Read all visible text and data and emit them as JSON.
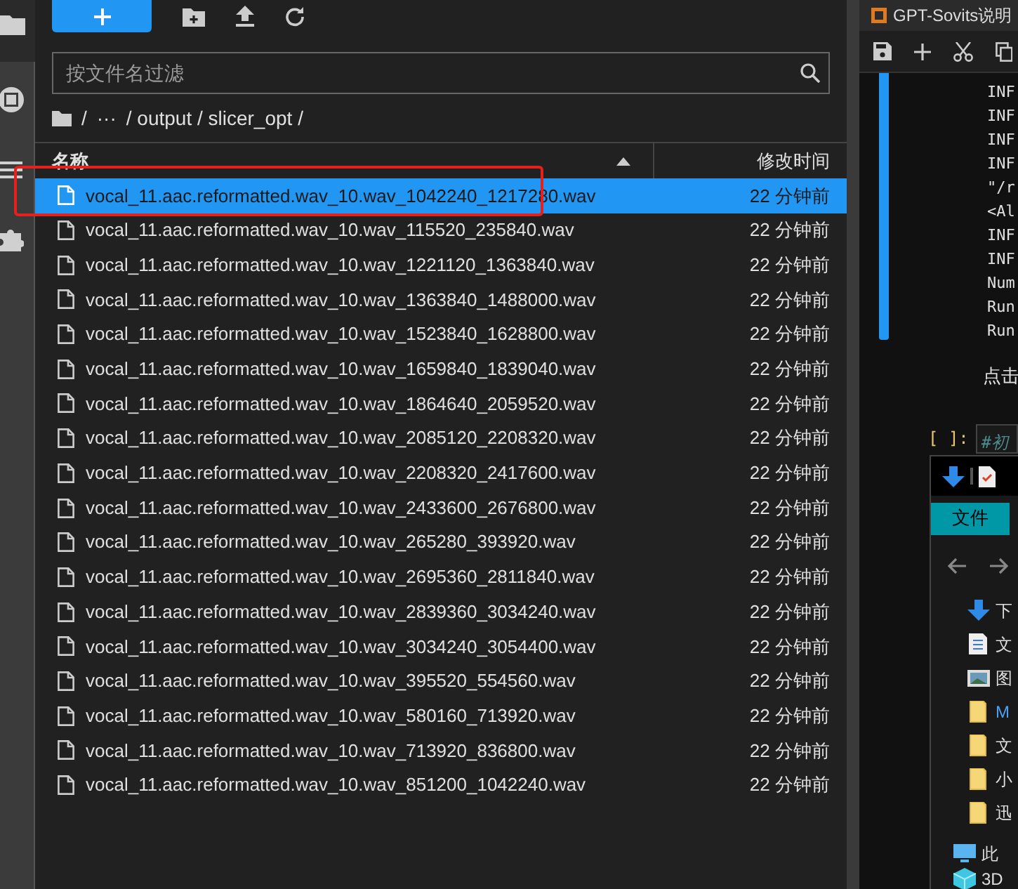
{
  "file_browser": {
    "filter": {
      "placeholder": "按文件名过滤"
    },
    "breadcrumb": [
      "/",
      "···",
      "/ output / slicer_opt /"
    ],
    "columns": [
      {
        "label": "名称",
        "sorted": true
      },
      {
        "label": "修改时间"
      }
    ],
    "files": [
      {
        "name": "vocal_11.aac.reformatted.wav_10.wav_1042240_1217280.wav",
        "modified": "22 分钟前",
        "selected": true
      },
      {
        "name": "vocal_11.aac.reformatted.wav_10.wav_115520_235840.wav",
        "modified": "22 分钟前",
        "selected": false
      },
      {
        "name": "vocal_11.aac.reformatted.wav_10.wav_1221120_1363840.wav",
        "modified": "22 分钟前",
        "selected": false
      },
      {
        "name": "vocal_11.aac.reformatted.wav_10.wav_1363840_1488000.wav",
        "modified": "22 分钟前",
        "selected": false
      },
      {
        "name": "vocal_11.aac.reformatted.wav_10.wav_1523840_1628800.wav",
        "modified": "22 分钟前",
        "selected": false
      },
      {
        "name": "vocal_11.aac.reformatted.wav_10.wav_1659840_1839040.wav",
        "modified": "22 分钟前",
        "selected": false
      },
      {
        "name": "vocal_11.aac.reformatted.wav_10.wav_1864640_2059520.wav",
        "modified": "22 分钟前",
        "selected": false
      },
      {
        "name": "vocal_11.aac.reformatted.wav_10.wav_2085120_2208320.wav",
        "modified": "22 分钟前",
        "selected": false
      },
      {
        "name": "vocal_11.aac.reformatted.wav_10.wav_2208320_2417600.wav",
        "modified": "22 分钟前",
        "selected": false
      },
      {
        "name": "vocal_11.aac.reformatted.wav_10.wav_2433600_2676800.wav",
        "modified": "22 分钟前",
        "selected": false
      },
      {
        "name": "vocal_11.aac.reformatted.wav_10.wav_265280_393920.wav",
        "modified": "22 分钟前",
        "selected": false
      },
      {
        "name": "vocal_11.aac.reformatted.wav_10.wav_2695360_2811840.wav",
        "modified": "22 分钟前",
        "selected": false
      },
      {
        "name": "vocal_11.aac.reformatted.wav_10.wav_2839360_3034240.wav",
        "modified": "22 分钟前",
        "selected": false
      },
      {
        "name": "vocal_11.aac.reformatted.wav_10.wav_3034240_3054400.wav",
        "modified": "22 分钟前",
        "selected": false
      },
      {
        "name": "vocal_11.aac.reformatted.wav_10.wav_395520_554560.wav",
        "modified": "22 分钟前",
        "selected": false
      },
      {
        "name": "vocal_11.aac.reformatted.wav_10.wav_580160_713920.wav",
        "modified": "22 分钟前",
        "selected": false
      },
      {
        "name": "vocal_11.aac.reformatted.wav_10.wav_713920_836800.wav",
        "modified": "22 分钟前",
        "selected": false
      },
      {
        "name": "vocal_11.aac.reformatted.wav_10.wav_851200_1042240.wav",
        "modified": "22 分钟前",
        "selected": false
      }
    ]
  },
  "notebook": {
    "tab_title": "GPT-Sovits说明",
    "output_lines": [
      "INF",
      "INF",
      "INF",
      "INF",
      "\"/r",
      "<Al",
      "INF",
      "INF",
      "Num",
      "Run",
      "Run"
    ],
    "markdown": "点击",
    "cell": {
      "prompt": "[ ]:",
      "code": "#初"
    }
  },
  "explorer": {
    "ribbon_tab": "文件",
    "items": [
      {
        "kind": "download",
        "label": "下"
      },
      {
        "kind": "document",
        "label": "文"
      },
      {
        "kind": "image",
        "label": "图"
      },
      {
        "kind": "folder",
        "label": "M"
      },
      {
        "kind": "folder",
        "label": "文"
      },
      {
        "kind": "folder",
        "label": "小"
      },
      {
        "kind": "folder",
        "label": "迅"
      },
      {
        "kind": "computer",
        "label": "此"
      },
      {
        "kind": "cube",
        "label": "3D"
      }
    ]
  }
}
